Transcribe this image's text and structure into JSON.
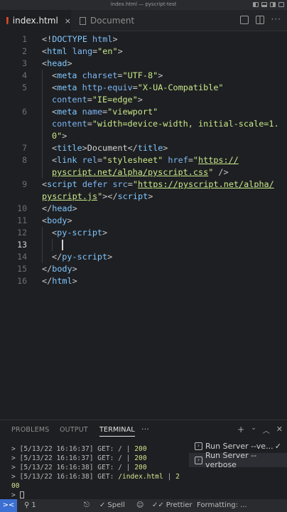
{
  "window": {
    "title": "index.html — pyscript-test"
  },
  "tabs": [
    {
      "label": "index.html",
      "close": "×"
    },
    {
      "label": "Document"
    }
  ],
  "editor": {
    "lines": [
      {
        "n": "1",
        "segs": [
          [
            "br",
            "<!"
          ],
          [
            "t",
            "DOCTYPE"
          ],
          [
            "at",
            " html"
          ],
          [
            "br",
            ">"
          ]
        ]
      },
      {
        "n": "2",
        "segs": [
          [
            "br",
            "<"
          ],
          [
            "t",
            "html"
          ],
          [
            "at",
            " lang"
          ],
          [
            "br",
            "="
          ],
          [
            "av",
            "\"en\""
          ],
          [
            "br",
            ">"
          ]
        ]
      },
      {
        "n": "3",
        "segs": [
          [
            "br",
            "<"
          ],
          [
            "t",
            "head"
          ],
          [
            "br",
            ">"
          ]
        ]
      },
      {
        "n": "4",
        "indent": 1,
        "segs": [
          [
            "br",
            "<"
          ],
          [
            "t",
            "meta"
          ],
          [
            "at",
            " charset"
          ],
          [
            "br",
            "="
          ],
          [
            "av",
            "\"UTF-8\""
          ],
          [
            "br",
            ">"
          ]
        ]
      },
      {
        "n": "5",
        "indent": 1,
        "segs": [
          [
            "br",
            "<"
          ],
          [
            "t",
            "meta"
          ],
          [
            "at",
            " http-equiv"
          ],
          [
            "br",
            "="
          ],
          [
            "av",
            "\"X-UA-Compatible\""
          ]
        ]
      },
      {
        "n": "",
        "indent": 1,
        "segs": [
          [
            "at",
            "content"
          ],
          [
            "br",
            "="
          ],
          [
            "av",
            "\"IE=edge\""
          ],
          [
            "br",
            ">"
          ]
        ]
      },
      {
        "n": "6",
        "indent": 1,
        "segs": [
          [
            "br",
            "<"
          ],
          [
            "t",
            "meta"
          ],
          [
            "at",
            " name"
          ],
          [
            "br",
            "="
          ],
          [
            "av",
            "\"viewport\""
          ]
        ]
      },
      {
        "n": "",
        "indent": 1,
        "segs": [
          [
            "at",
            "content"
          ],
          [
            "br",
            "="
          ],
          [
            "av",
            "\"width=device-width, initial-scale=1."
          ]
        ]
      },
      {
        "n": "",
        "indent": 1,
        "segs": [
          [
            "av",
            "0\""
          ],
          [
            "br",
            ">"
          ]
        ]
      },
      {
        "n": "7",
        "indent": 1,
        "segs": [
          [
            "br",
            "<"
          ],
          [
            "t",
            "title"
          ],
          [
            "br",
            ">"
          ],
          [
            "tx",
            "Document"
          ],
          [
            "br",
            "</"
          ],
          [
            "t",
            "title"
          ],
          [
            "br",
            ">"
          ]
        ]
      },
      {
        "n": "8",
        "indent": 1,
        "segs": [
          [
            "br",
            "<"
          ],
          [
            "t",
            "link"
          ],
          [
            "at",
            " rel"
          ],
          [
            "br",
            "="
          ],
          [
            "av",
            "\"stylesheet\""
          ],
          [
            "at",
            " href"
          ],
          [
            "br",
            "="
          ],
          [
            "av",
            "\""
          ],
          [
            "lk",
            "https://"
          ]
        ]
      },
      {
        "n": "",
        "indent": 1,
        "segs": [
          [
            "lk",
            "pyscript.net/alpha/pyscript.css"
          ],
          [
            "av",
            "\""
          ],
          [
            "br",
            " />"
          ]
        ]
      },
      {
        "n": "9",
        "segs": [
          [
            "br",
            "<"
          ],
          [
            "t",
            "script"
          ],
          [
            "at",
            " defer src"
          ],
          [
            "br",
            "="
          ],
          [
            "av",
            "\""
          ],
          [
            "lk",
            "https://pyscript.net/alpha/"
          ]
        ]
      },
      {
        "n": "",
        "segs": [
          [
            "lk",
            "pyscript.js"
          ],
          [
            "av",
            "\""
          ],
          [
            "br",
            "></"
          ],
          [
            "t",
            "script"
          ],
          [
            "br",
            ">"
          ]
        ]
      },
      {
        "n": "10",
        "segs": [
          [
            "br",
            "</"
          ],
          [
            "t",
            "head"
          ],
          [
            "br",
            ">"
          ]
        ]
      },
      {
        "n": "11",
        "segs": [
          [
            "br",
            "<"
          ],
          [
            "t",
            "body"
          ],
          [
            "br",
            ">"
          ]
        ]
      },
      {
        "n": "12",
        "indent": 1,
        "segs": [
          [
            "br",
            "<"
          ],
          [
            "t",
            "py-script"
          ],
          [
            "br",
            ">"
          ]
        ]
      },
      {
        "n": "13",
        "indent": 2,
        "current": true,
        "cursor": true,
        "segs": []
      },
      {
        "n": "14",
        "indent": 1,
        "segs": [
          [
            "br",
            "</"
          ],
          [
            "t",
            "py-script"
          ],
          [
            "br",
            ">"
          ]
        ]
      },
      {
        "n": "15",
        "segs": [
          [
            "br",
            "</"
          ],
          [
            "t",
            "body"
          ],
          [
            "br",
            ">"
          ]
        ]
      },
      {
        "n": "16",
        "segs": [
          [
            "br",
            "</"
          ],
          [
            "t",
            "html"
          ],
          [
            "br",
            ">"
          ]
        ]
      }
    ]
  },
  "panel": {
    "tabs": [
      "PROBLEMS",
      "OUTPUT",
      "TERMINAL"
    ],
    "active_tab": "TERMINAL",
    "more": "···",
    "terminal_lines": [
      {
        "prefix": "> [5/13/22 16:16:37] GET: / | ",
        "num": "200"
      },
      {
        "prefix": "> [5/13/22 16:16:37] GET: / | ",
        "num": "200"
      },
      {
        "prefix": "> [5/13/22 16:16:38] GET: / | ",
        "num": "200"
      },
      {
        "prefix": "> [5/13/22 16:16:38] GET: ",
        "path": "/index.html",
        "mid": " | ",
        "num": "2"
      },
      {
        "prefix": "",
        "num": "00"
      }
    ],
    "prompt": ">",
    "terminals": [
      {
        "label": "Run Server --ve...",
        "check": "✓",
        "selected": false
      },
      {
        "label": "Run Server --verbose",
        "selected": true
      }
    ]
  },
  "statusbar": {
    "remote_icon": "><",
    "ports": "1",
    "spell": "Spell",
    "prettier": "Prettier",
    "formatting": "Formatting: ..."
  }
}
